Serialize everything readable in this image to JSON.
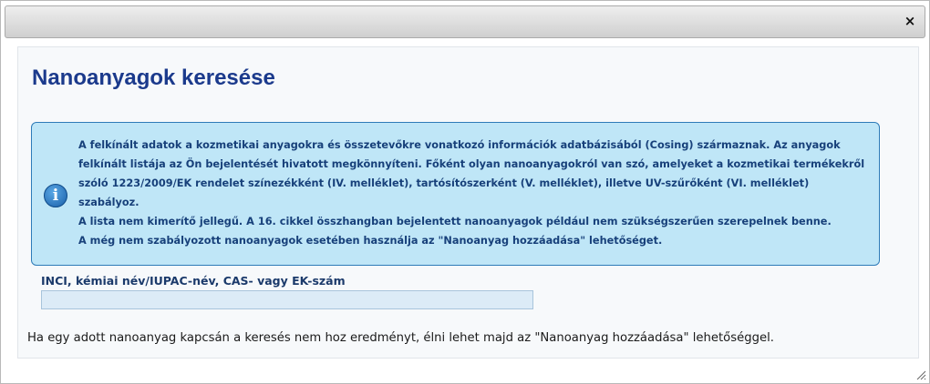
{
  "dialog": {
    "close_icon": "close-icon",
    "close_glyph": "×"
  },
  "page": {
    "title": "Nanoanyagok keresése"
  },
  "info_box": {
    "icon": "info-icon",
    "icon_glyph": "i",
    "paragraphs": [
      "A felkínált adatok a kozmetikai anyagokra és összetevőkre vonatkozó információk adatbázisából (Cosing) származnak. Az anyagok felkínált listája az Ön bejelentését hivatott megkönnyíteni. Főként olyan nanoanyagokról van szó, amelyeket a kozmetikai termékekről szóló 1223/2009/EK rendelet színezékként (IV. melléklet), tartósítószerként (V. melléklet), illetve UV-szűrőként (VI. melléklet) szabályoz.",
      "A lista nem kimerítő jellegű. A 16. cikkel összhangban bejelentett nanoanyagok például nem szükségszerűen szerepelnek benne.",
      "A még nem szabályozott nanoanyagok esetében használja az \"Nanoanyag hozzáadása\" lehetőséget."
    ]
  },
  "search": {
    "label": "INCI, kémiai név/IUPAC-név, CAS- vagy EK-szám",
    "value": "",
    "placeholder": ""
  },
  "hint": "Ha egy adott nanoanyag kapcsán a keresés nem hoz eredményt, élni lehet majd az \"Nanoanyag hozzáadása\" lehetőséggel.",
  "colors": {
    "title": "#1b3a8c",
    "info_background": "#bfe6f7",
    "info_border": "#2e7bb8",
    "info_text": "#17407a",
    "input_background": "#dcebf7"
  }
}
